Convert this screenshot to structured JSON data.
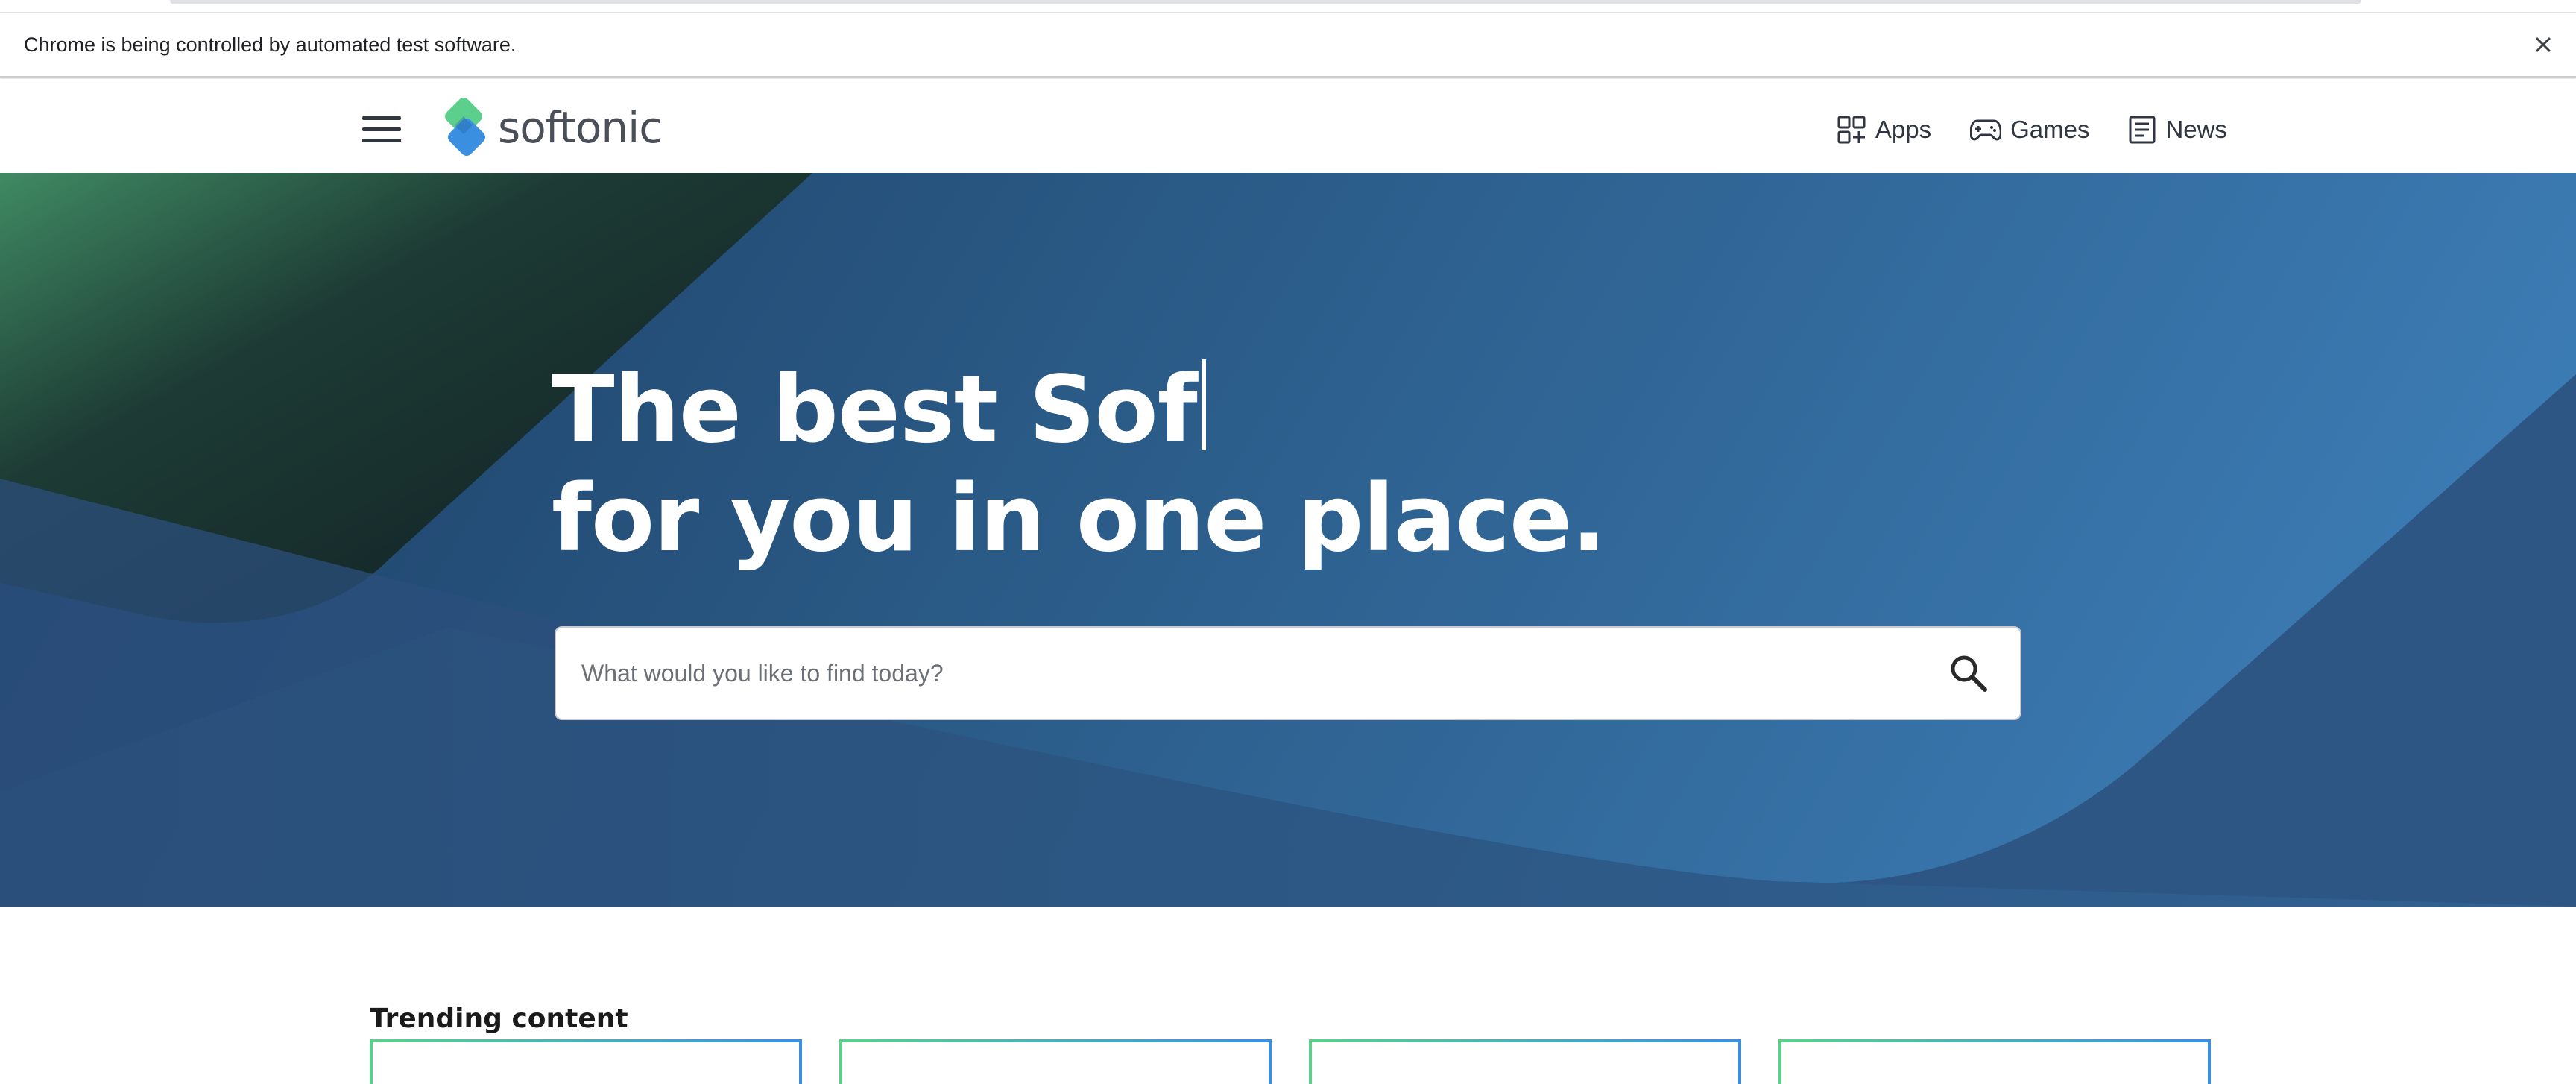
{
  "browser": {
    "infobar_text": "Chrome is being controlled by automated test software.",
    "close_icon": "close-icon"
  },
  "header": {
    "menu_icon": "hamburger-icon",
    "logo_text": "softonic",
    "nav": [
      {
        "label": "Apps",
        "icon": "apps-grid-icon"
      },
      {
        "label": "Games",
        "icon": "gamepad-icon"
      },
      {
        "label": "News",
        "icon": "newspaper-icon"
      }
    ]
  },
  "hero": {
    "title_line1": "The best Sof",
    "title_line2": "for you in one place.",
    "search_placeholder": "What would you like to find today?",
    "search_icon": "search-icon"
  },
  "trending": {
    "title": "Trending content",
    "cards": [
      {},
      {},
      {},
      {}
    ]
  },
  "colors": {
    "hero_dark": "#1c3d63",
    "hero_light": "#3f82bd",
    "accent_green": "#5ccf8c",
    "accent_blue": "#3b8fe0"
  }
}
